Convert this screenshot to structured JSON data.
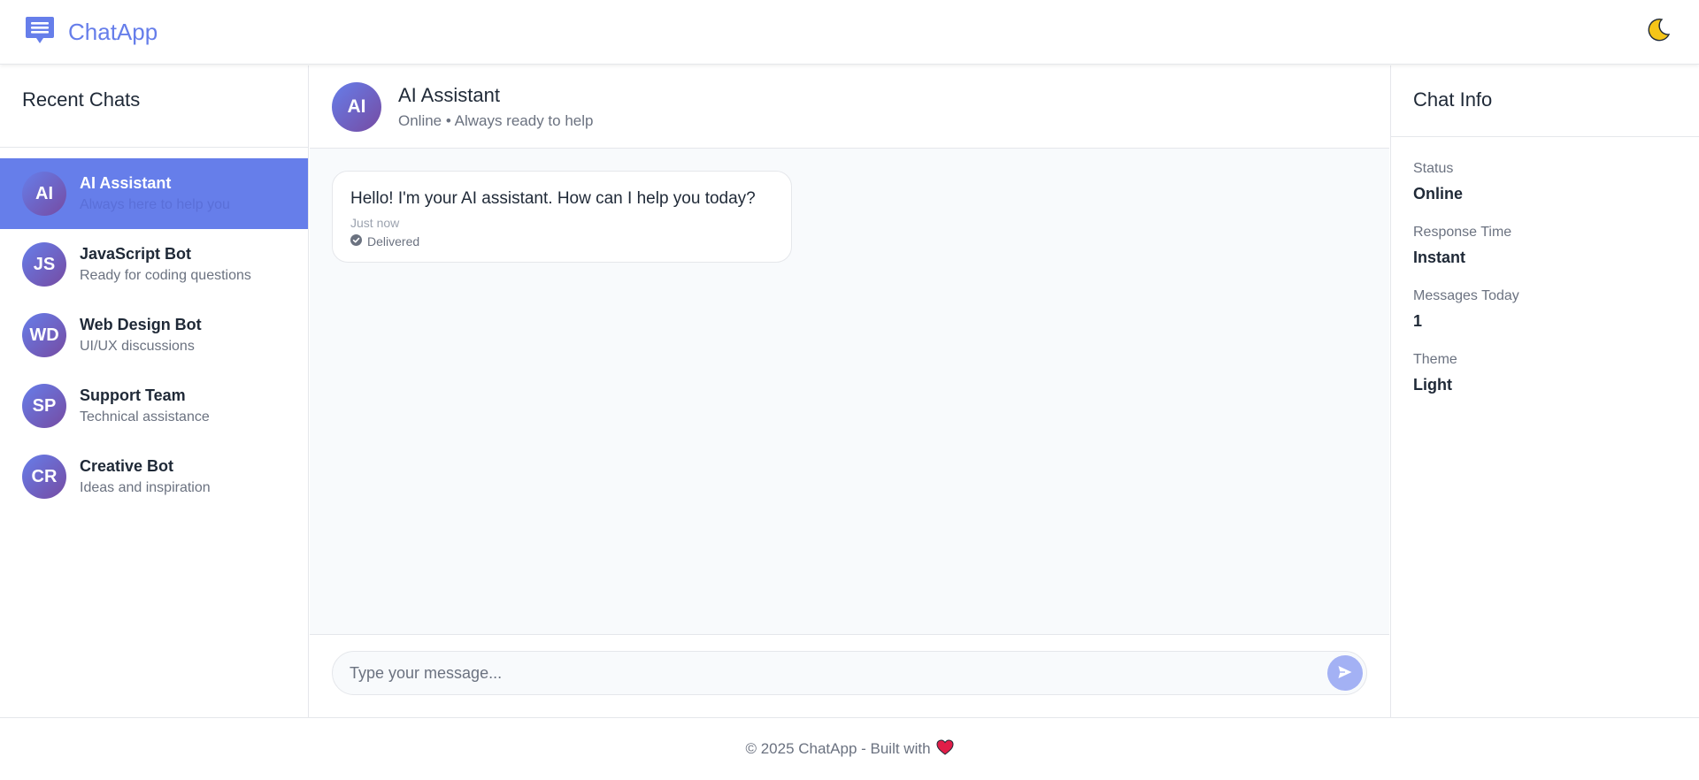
{
  "header": {
    "brand_name": "ChatApp",
    "brand_icon": "chat-bubble-icon",
    "theme_toggle_icon": "moon-icon"
  },
  "sidebar": {
    "title": "Recent Chats",
    "items": [
      {
        "initials": "AI",
        "name": "AI Assistant",
        "subtitle": "Always here to help you",
        "active": true
      },
      {
        "initials": "JS",
        "name": "JavaScript Bot",
        "subtitle": "Ready for coding questions",
        "active": false
      },
      {
        "initials": "WD",
        "name": "Web Design Bot",
        "subtitle": "UI/UX discussions",
        "active": false
      },
      {
        "initials": "SP",
        "name": "Support Team",
        "subtitle": "Technical assistance",
        "active": false
      },
      {
        "initials": "CR",
        "name": "Creative Bot",
        "subtitle": "Ideas and inspiration",
        "active": false
      }
    ]
  },
  "chat": {
    "initials": "AI",
    "name": "AI Assistant",
    "status": "Online • Always ready to help",
    "messages": [
      {
        "text": "Hello! I'm your AI assistant. How can I help you today?",
        "time": "Just now",
        "status": "Delivered"
      }
    ],
    "input_placeholder": "Type your message...",
    "input_value": "",
    "send_icon": "send-icon"
  },
  "info": {
    "title": "Chat Info",
    "rows": [
      {
        "label": "Status",
        "value": "Online"
      },
      {
        "label": "Response Time",
        "value": "Instant"
      },
      {
        "label": "Messages Today",
        "value": "1"
      },
      {
        "label": "Theme",
        "value": "Light"
      }
    ]
  },
  "footer": {
    "text": "© 2025 ChatApp - Built with",
    "heart_icon": "heart-icon"
  },
  "colors": {
    "accent": "#667eea",
    "avatar_gradient_end": "#764ba2",
    "send_button": "#a3b1f4",
    "heart": "#e11d48"
  }
}
